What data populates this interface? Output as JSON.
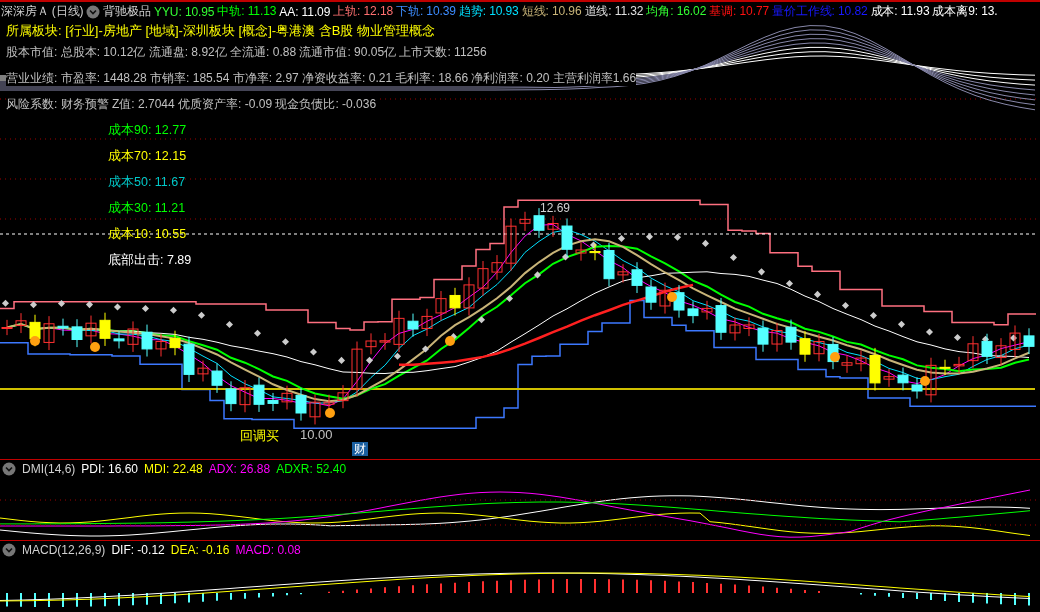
{
  "header": {
    "stock": "深深房Ａ (日线)",
    "formula": "背驰极品",
    "indicators": [
      {
        "label": "YYU: 10.95",
        "color": "#33ff33"
      },
      {
        "label": "中轨: 11.13",
        "color": "#00ff00"
      },
      {
        "label": "AA: 11.09",
        "color": "#ffffff"
      },
      {
        "label": "上轨: 12.18",
        "color": "#ff7070"
      },
      {
        "label": "下轨: 10.39",
        "color": "#3c8cff"
      },
      {
        "label": "趋势: 10.93",
        "color": "#00e0ff"
      },
      {
        "label": "短线: 10.96",
        "color": "#c8b478"
      },
      {
        "label": "道线: 11.32",
        "color": "#e0e0e0"
      },
      {
        "label": "均角: 16.02",
        "color": "#33ff33"
      },
      {
        "label": "基调: 10.77",
        "color": "#ff1010"
      },
      {
        "label": "量价工作线: 10.82",
        "color": "#1818ff"
      },
      {
        "label": "成本: 11.93",
        "color": "#ffffff"
      },
      {
        "label": "成本离9: 13.",
        "color": "#ffffff"
      }
    ]
  },
  "sector": "所属板块: [行业]-房地产 [地域]-深圳板块 [概念]-粤港澳 含B股 物业管理概念",
  "info_lines": [
    "股本市值: 总股本: 10.12亿 流通盘: 8.92亿 全流通: 0.88 流通市值: 90.05亿 上市天数: 11256",
    "营业业绩: 市盈率: 1448.28 市销率: 185.54 市净率: 2.97 净资收益率: 0.21 毛利率: 18.66 净利润率: 0.20 主营利润率1.66",
    "风险系数: 财务预警 Z值: 2.7044 优质资产率: -0.09 现金负债比: -0.036"
  ],
  "cost_labels": [
    {
      "label": "成本90: 12.77",
      "color": "#00ff00"
    },
    {
      "label": "成本70: 12.15",
      "color": "#ffff00"
    },
    {
      "label": "成本50: 11.67",
      "color": "#00c8c8"
    },
    {
      "label": "成本30: 11.21",
      "color": "#00ff00"
    },
    {
      "label": "成本10: 10.55",
      "color": "#ffff00"
    },
    {
      "label": "底部出击: 7.89",
      "color": "#ffffff"
    }
  ],
  "annotations": {
    "high": "12.69",
    "low": "10.00",
    "buy_signal": "回调买",
    "badge": "财"
  },
  "panels": [
    {
      "title": "DMI(14,6)",
      "kind": "dmi",
      "values": [
        {
          "label": "PDI: 16.60",
          "color": "#ffffff"
        },
        {
          "label": "MDI: 22.48",
          "color": "#ffff00"
        },
        {
          "label": "ADX: 26.88",
          "color": "#ff00ff"
        },
        {
          "label": "ADXR: 52.40",
          "color": "#00ff00"
        }
      ]
    },
    {
      "title": "MACD(12,26,9)",
      "kind": "macd",
      "values": [
        {
          "label": "DIF: -0.12",
          "color": "#ffffff"
        },
        {
          "label": "DEA: -0.16",
          "color": "#ffff00"
        },
        {
          "label": "MACD: 0.08",
          "color": "#ff00ff"
        }
      ]
    }
  ]
}
